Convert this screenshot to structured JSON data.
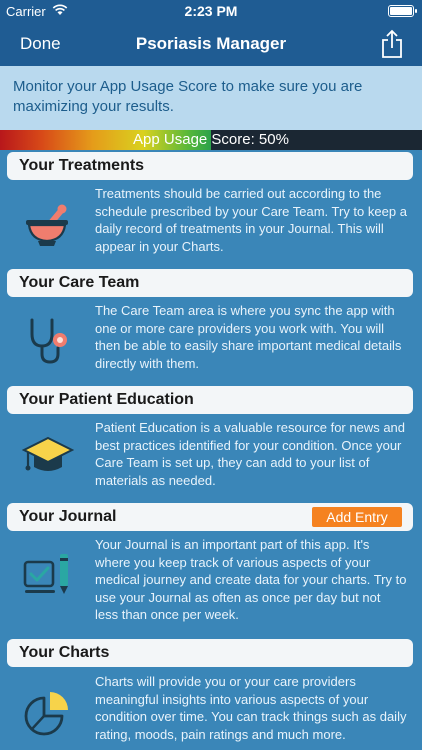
{
  "status": {
    "carrier": "Carrier",
    "time": "2:23 PM"
  },
  "nav": {
    "done": "Done",
    "title": "Psoriasis Manager",
    "share_icon": "share-icon"
  },
  "banner": {
    "text": "Monitor your App Usage Score to make sure you are maximizing your results."
  },
  "usage": {
    "label": "App Usage Score: 50%",
    "score_percent": 50
  },
  "sections": [
    {
      "title": "Your Treatments",
      "icon": "mortar-pestle-icon",
      "text": "Treatments should be carried out according to the schedule prescribed by your Care Team. Try to keep a daily record of treatments in your Journal. This will appear in your Charts."
    },
    {
      "title": "Your Care Team",
      "icon": "stethoscope-icon",
      "text": "The Care Team area is where you sync the app with one or more care providers you work with. You will then be able to easily share important medical details directly with them."
    },
    {
      "title": "Your Patient Education",
      "icon": "graduation-cap-icon",
      "text": "Patient Education is a valuable resource for news and best practices identified for your condition. Once your Care Team is set up, they can add to your list of materials as needed."
    },
    {
      "title": "Your Journal",
      "icon": "journal-check-icon",
      "action": "Add Entry",
      "text": "Your Journal is an important part of this app. It's where you keep track of various aspects of your medical journey and create data for your charts. Try to use your Journal as often as once per day but not less than once per week."
    },
    {
      "title": "Your Charts",
      "icon": "pie-chart-icon",
      "text": "Charts will provide you or your care providers meaningful insights into various aspects of your condition over time. You can track things such as daily rating, moods, pain ratings and much more."
    }
  ]
}
